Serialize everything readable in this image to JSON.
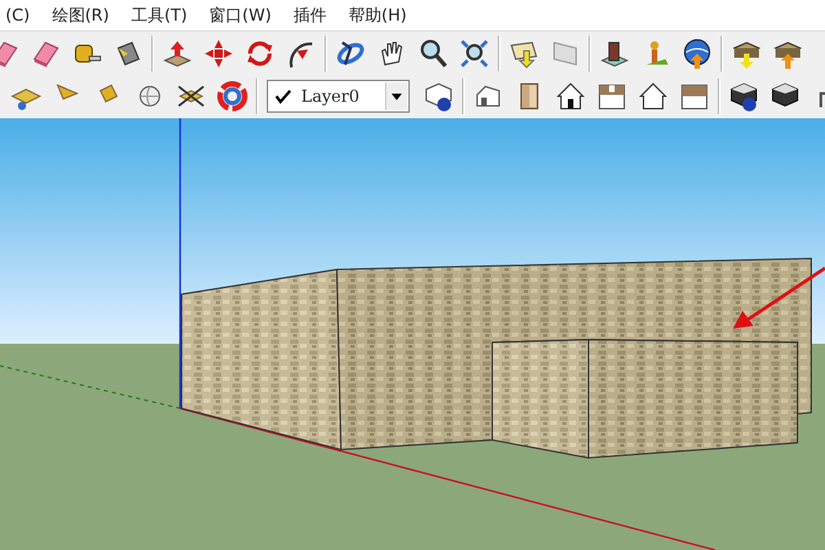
{
  "menu_bar": [
    {
      "label": "(C)"
    },
    {
      "label": "绘图(R)"
    },
    {
      "label": "工具(T)"
    },
    {
      "label": "窗口(W)"
    },
    {
      "label": "插件"
    },
    {
      "label": "帮助(H)"
    }
  ],
  "layer_select": {
    "value": "Layer0",
    "checked": true
  }
}
